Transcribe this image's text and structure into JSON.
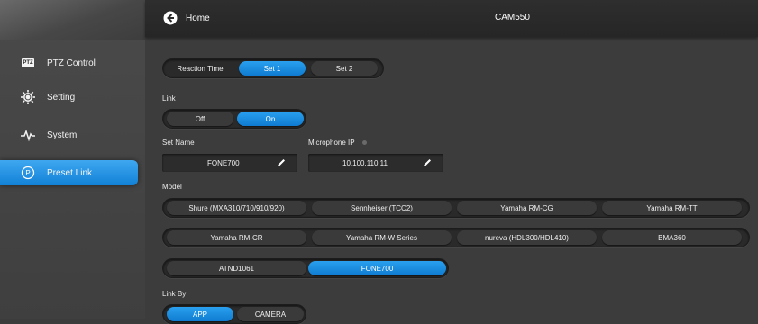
{
  "header": {
    "home_label": "Home",
    "device_title": "CAM550"
  },
  "sidebar": {
    "items": [
      {
        "label": "PTZ Control",
        "icon": "ptz-icon",
        "active": false,
        "badge": "PTZ"
      },
      {
        "label": "Setting",
        "icon": "gear-icon",
        "active": false
      },
      {
        "label": "System",
        "icon": "pulse-icon",
        "active": false
      },
      {
        "label": "Preset Link",
        "icon": "preset-link-icon",
        "active": true
      }
    ]
  },
  "reaction_time": {
    "label": "Reaction Time",
    "options": [
      "Set 1",
      "Set 2"
    ],
    "selected": "Set 1"
  },
  "link": {
    "label": "Link",
    "options": [
      "Off",
      "On"
    ],
    "selected": "On"
  },
  "set_name": {
    "label": "Set Name",
    "value": "FONE700"
  },
  "microphone_ip": {
    "label": "Microphone IP",
    "value": "10.100.110.11"
  },
  "model": {
    "label": "Model",
    "rows": [
      [
        "Shure (MXA310/710/910/920)",
        "Sennheiser (TCC2)",
        "Yamaha RM-CG",
        "Yamaha RM-TT"
      ],
      [
        "Yamaha RM-CR",
        "Yamaha RM-W Series",
        "nureva (HDL300/HDL410)",
        "BMA360"
      ],
      [
        "ATND1061",
        "FONE700"
      ]
    ],
    "selected": "FONE700"
  },
  "link_by": {
    "label": "Link By",
    "options": [
      "APP",
      "CAMERA"
    ],
    "selected": "APP"
  },
  "colors": {
    "accent": "#1a8fe3",
    "background": "#3c3c3c",
    "topbar": "#2a2a2a",
    "sidebar": "#444444"
  }
}
